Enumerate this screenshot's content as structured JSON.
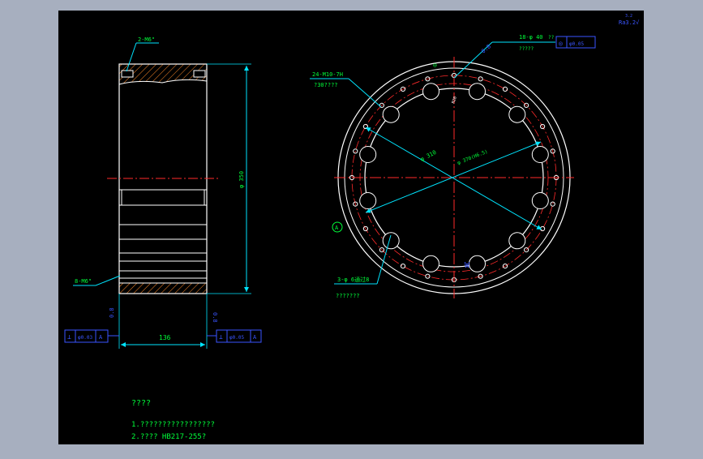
{
  "colors": {
    "background_outer": "#a7afbf",
    "sheet": "#000000",
    "line_white": "#ffffff",
    "line_red": "#ff2a2a",
    "dim_cyan": "#00e5ff",
    "text_green": "#00ff3a",
    "tol_blue": "#3a55ff",
    "hatch_orange": "#ff8a2a",
    "mark_yellow": "#ffff00"
  },
  "section_view": {
    "top_note": "2-M6\"",
    "bottom_note": "8-M6\"",
    "height_dim": "φ 350",
    "width_dim": "136",
    "left_fcf": [
      "⊥",
      "φ0.03",
      "A"
    ],
    "right_fcf": [
      "⊥",
      "φ0.05",
      "A"
    ],
    "side_mark_left": "0.8",
    "side_mark_right": "0.8"
  },
  "front_view": {
    "tl_callout_line1": "24-M10-7H",
    "tl_callout_line2": "?30????",
    "tr_callout_line1": "18-φ 40",
    "tr_callout_line2": "??",
    "tr_callout_line3": "?????",
    "tr_fcf": [
      "◎",
      "φ0.05"
    ],
    "roughness_top": "0.8",
    "roughness_corner": "Ra3.2√",
    "corner_small": "3.2",
    "dia1": "φ 310",
    "dia2": "φ 370(H6.5)",
    "bottom_callout_line1": "3-φ 6通过8",
    "bottom_callout_line2": "???????",
    "datum": "A",
    "w_mark": "W",
    "tag_small": "R20"
  },
  "notes": {
    "title": "????",
    "line1": "1.?????????????????",
    "line2": "2.???? HB217-255?"
  }
}
